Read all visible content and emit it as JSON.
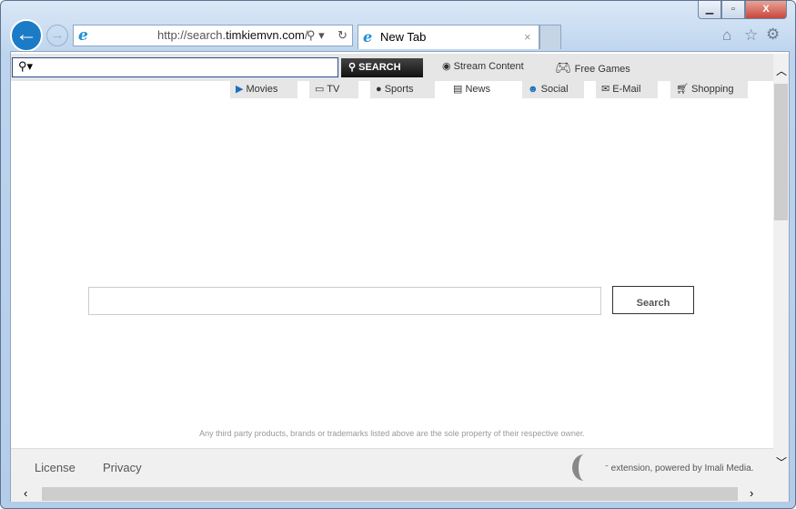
{
  "browser": {
    "url_prefix": "http://search.",
    "url_domain": "timkiemvn.com",
    "url_suffix": "/",
    "tab_title": "New Tab",
    "window_controls": {
      "minimize": "▁",
      "maximize": "▫",
      "close": "X"
    }
  },
  "toolbar": {
    "search_placeholder": "",
    "search_button": "SEARCH",
    "stream": "Stream Content",
    "games": "Free Games"
  },
  "nav": [
    {
      "label": "Movies",
      "icon": "clapper-icon"
    },
    {
      "label": "TV",
      "icon": "tv-icon"
    },
    {
      "label": "Sports",
      "icon": "basketball-icon"
    },
    {
      "label": "News",
      "icon": "newspaper-icon"
    },
    {
      "label": "Social",
      "icon": "people-icon"
    },
    {
      "label": "E-Mail",
      "icon": "envelope-icon"
    },
    {
      "label": "Shopping",
      "icon": "cart-icon"
    }
  ],
  "main": {
    "search_value": "",
    "search_button": "Search",
    "disclaimer": "Any third party products, brands or trademarks listed above are the sole property of their respective owner."
  },
  "footer": {
    "license": "License",
    "privacy": "Privacy",
    "powered": "extension, powered by Imali Media."
  },
  "colors": {
    "back_button": "#1b7bc6",
    "close_button": "#c9463d"
  }
}
